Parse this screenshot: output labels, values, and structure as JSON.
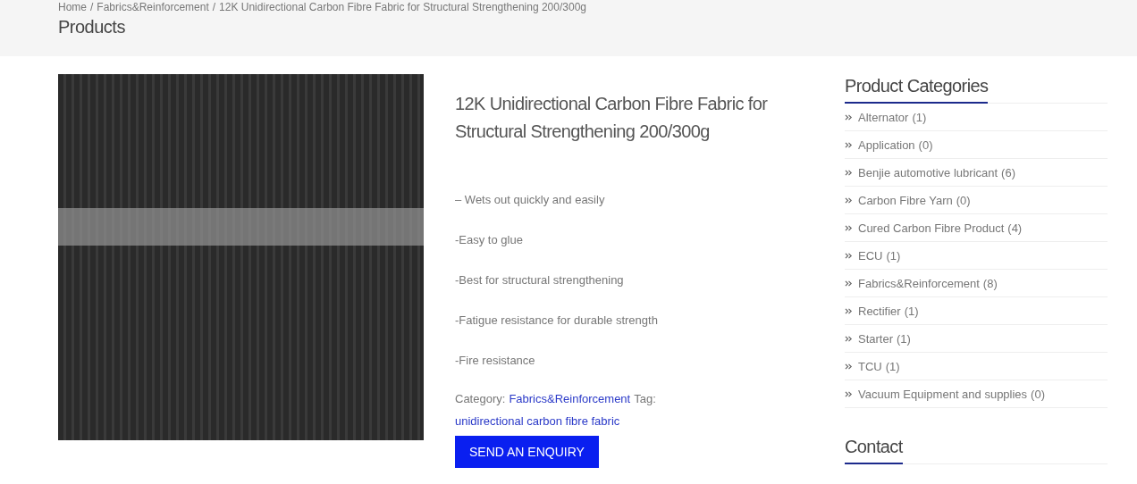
{
  "header": {
    "breadcrumb": [
      {
        "label": "Home"
      },
      {
        "label": "Fabrics&Reinforcement"
      },
      {
        "label": "12K Unidirectional Carbon Fibre Fabric for Structural Strengthening 200/300g"
      }
    ],
    "separator": "/",
    "title": "Products"
  },
  "product": {
    "title": "12K Unidirectional Carbon Fibre Fabric for Structural Strengthening 200/300g",
    "features": [
      "– Wets out quickly and easily",
      "-Easy to glue",
      "-Best for structural strengthening",
      "-Fatigue resistance for durable strength",
      "-Fire resistance"
    ],
    "category_label": "Category:",
    "category": "Fabrics&Reinforcement",
    "tag_label": "Tag:",
    "tag": "unidirectional carbon fibre fabric",
    "button": "SEND AN ENQUIRY"
  },
  "sidebar": {
    "categories_title": "Product Categories",
    "categories": [
      {
        "name": "Alternator",
        "count": "(1)"
      },
      {
        "name": "Application",
        "count": "(0)"
      },
      {
        "name": "Benjie automotive lubricant",
        "count": "(6)"
      },
      {
        "name": "Carbon Fibre Yarn",
        "count": "(0)"
      },
      {
        "name": "Cured Carbon Fibre Product",
        "count": "(4)"
      },
      {
        "name": "ECU",
        "count": "(1)"
      },
      {
        "name": "Fabrics&Reinforcement",
        "count": "(8)"
      },
      {
        "name": "Rectifier",
        "count": "(1)"
      },
      {
        "name": "Starter",
        "count": "(1)"
      },
      {
        "name": "TCU",
        "count": "(1)"
      },
      {
        "name": "Vacuum Equipment and supplies",
        "count": "(0)"
      }
    ],
    "contact_title": "Contact"
  }
}
